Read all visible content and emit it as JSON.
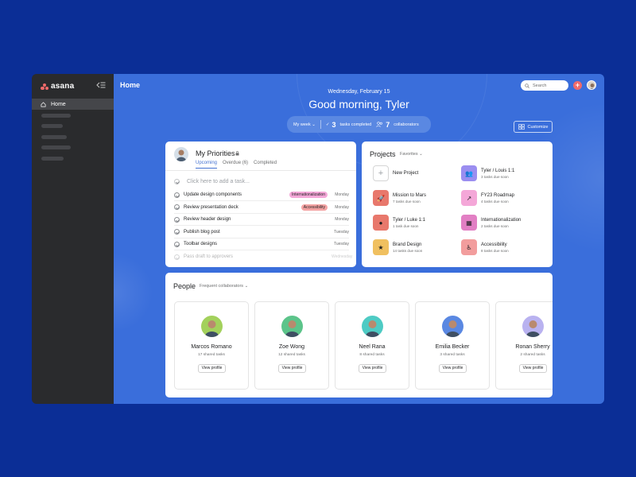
{
  "app": {
    "name": "asana"
  },
  "sidebar": {
    "items": [
      {
        "label": "Home",
        "icon": "home-icon"
      }
    ]
  },
  "header": {
    "title": "Home",
    "search_placeholder": "Search",
    "add_label": "+"
  },
  "hero": {
    "date": "Wednesday, February 15",
    "greeting": "Good morning, Tyler",
    "period": "My week",
    "tasks_count": "3",
    "tasks_label": "tasks completed",
    "collab_count": "7",
    "collab_label": "collaborators",
    "customize": "Customize"
  },
  "priorities": {
    "title": "My Priorities",
    "tabs": [
      "Upcoming",
      "Overdue (6)",
      "Completed"
    ],
    "add_task": "Click here to add a task...",
    "tasks": [
      {
        "name": "Update design components",
        "tag": "Internationalization",
        "tag_color": "#f4a7d8",
        "day": "Monday"
      },
      {
        "name": "Review presentation deck",
        "tag": "Accessibility",
        "tag_color": "#f4a3a3",
        "day": "Monday"
      },
      {
        "name": "Review header design",
        "tag": "",
        "day": "Monday"
      },
      {
        "name": "Publish blog post",
        "tag": "",
        "day": "Tuesday"
      },
      {
        "name": "Toolbar designs",
        "tag": "",
        "day": "Tuesday"
      },
      {
        "name": "Pass draft to approvers",
        "tag": "",
        "day": "Wednesday"
      }
    ]
  },
  "projects": {
    "title": "Projects",
    "filter": "Favorites",
    "items": [
      {
        "name": "New Project",
        "sub": "",
        "color": "#ffffff",
        "icon": "plus-icon"
      },
      {
        "name": "Tyler / Louis 1:1",
        "sub": "3 tasks due soon",
        "color": "#9b8ef0",
        "icon": "people-icon"
      },
      {
        "name": "Mission to Mars",
        "sub": "7 tasks due soon",
        "color": "#e8786c",
        "icon": "rocket-icon"
      },
      {
        "name": "FY23 Roadmap",
        "sub": "4 tasks due soon",
        "color": "#f4a7d8",
        "icon": "trend-icon"
      },
      {
        "name": "Tyler / Luke 1:1",
        "sub": "1 task due soon",
        "color": "#e8786c",
        "icon": "chat-icon"
      },
      {
        "name": "Internationalization",
        "sub": "2 tasks due soon",
        "color": "#e27fc4",
        "icon": "grid-icon"
      },
      {
        "name": "Brand Design",
        "sub": "14 tasks due soon",
        "color": "#f0c060",
        "icon": "star-icon"
      },
      {
        "name": "Accessibility",
        "sub": "8 tasks due soon",
        "color": "#f29d9d",
        "icon": "accessibility-icon"
      }
    ]
  },
  "people": {
    "title": "People",
    "filter": "Frequent collaborators",
    "view_label": "View profile",
    "items": [
      {
        "name": "Marcos Romano",
        "sub": "17 shared tasks",
        "color": "#a3d15c"
      },
      {
        "name": "Zoe Wong",
        "sub": "12 shared tasks",
        "color": "#5cc48a"
      },
      {
        "name": "Neel Rana",
        "sub": "8 shared tasks",
        "color": "#4ecbc4"
      },
      {
        "name": "Emilia Becker",
        "sub": "3 shared tasks",
        "color": "#5a88e2"
      },
      {
        "name": "Ronan Sherry",
        "sub": "2 shared tasks",
        "color": "#b9b2f0"
      }
    ]
  },
  "colors": {
    "accent": "#4573d2",
    "brand": "#f06a6a",
    "main_bg": "#3a6edb",
    "page_bg": "#0b2e96",
    "sidebar": "#2a2b2d"
  }
}
